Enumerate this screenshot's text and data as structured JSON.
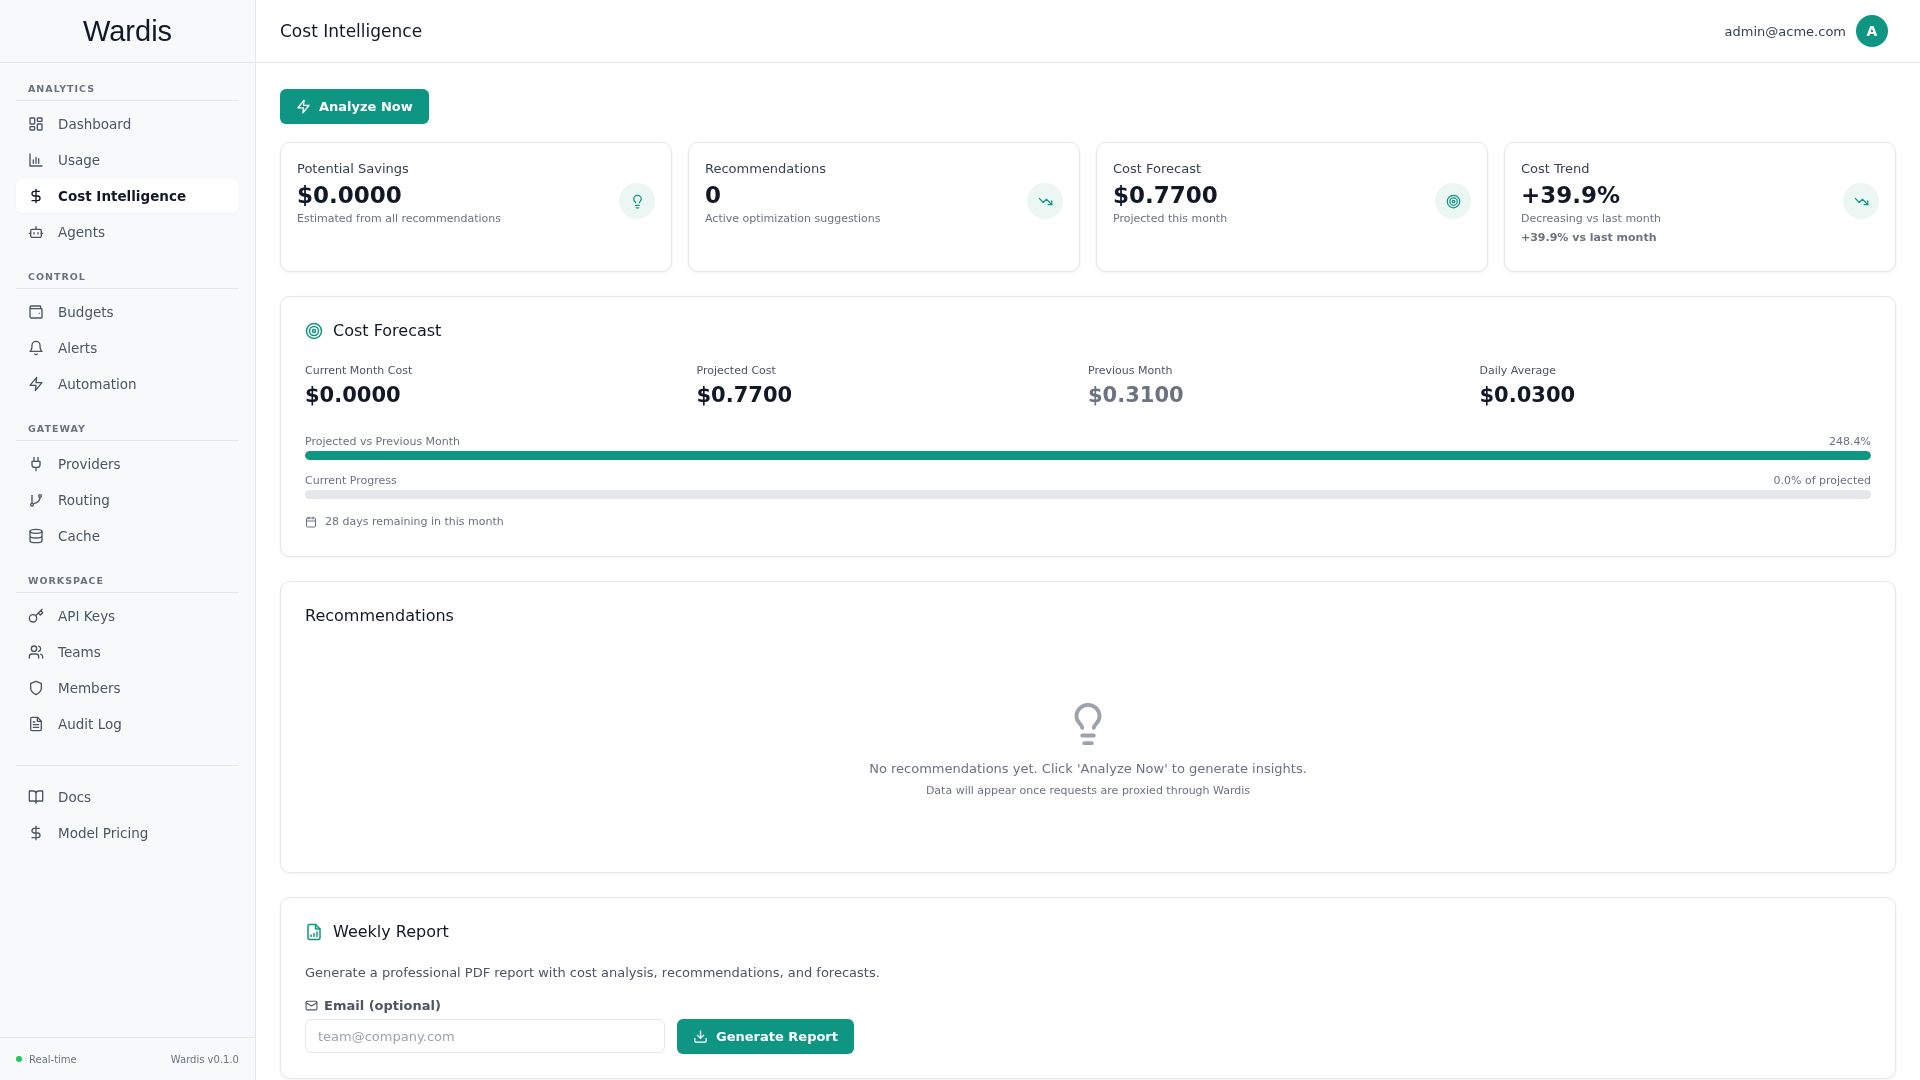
{
  "sidebar": {
    "logo": "Wardis",
    "sections": [
      {
        "title": "ANALYTICS",
        "items": [
          {
            "label": "Dashboard",
            "selected": false
          },
          {
            "label": "Usage",
            "selected": false
          },
          {
            "label": "Cost Intelligence",
            "selected": true
          },
          {
            "label": "Agents",
            "selected": false
          }
        ]
      },
      {
        "title": "CONTROL",
        "items": [
          {
            "label": "Budgets",
            "selected": false
          },
          {
            "label": "Alerts",
            "selected": false
          },
          {
            "label": "Automation",
            "selected": false
          }
        ]
      },
      {
        "title": "GATEWAY",
        "items": [
          {
            "label": "Providers",
            "selected": false
          },
          {
            "label": "Routing",
            "selected": false
          },
          {
            "label": "Cache",
            "selected": false
          }
        ]
      },
      {
        "title": "WORKSPACE",
        "items": [
          {
            "label": "API Keys",
            "selected": false
          },
          {
            "label": "Teams",
            "selected": false
          },
          {
            "label": "Members",
            "selected": false
          },
          {
            "label": "Audit Log",
            "selected": false
          }
        ]
      }
    ],
    "links": [
      {
        "label": "Docs",
        "selected": false
      },
      {
        "label": "Model Pricing",
        "selected": false
      }
    ],
    "status": "Real-time",
    "version": "Wardis v0.1.0"
  },
  "header": {
    "title": "Cost Intelligence",
    "user": "admin@acme.com",
    "avatar": "A"
  },
  "analyze_button": "Analyze Now",
  "stat_cards": [
    {
      "title": "Potential Savings",
      "value": "$0.0000",
      "caption": "Estimated from all recommendations"
    },
    {
      "title": "Recommendations",
      "value": "0",
      "caption": "Active optimization suggestions"
    },
    {
      "title": "Cost Forecast",
      "value": "$0.7700",
      "caption": "Projected this month"
    },
    {
      "title": "Cost Trend",
      "value": "+39.9%",
      "caption": "Decreasing vs last month",
      "note": "+39.9% vs last month"
    }
  ],
  "forecast": {
    "title": "Cost Forecast",
    "metrics": [
      {
        "label": "Current Month Cost",
        "value": "$0.0000",
        "muted": false
      },
      {
        "label": "Projected Cost",
        "value": "$0.7700",
        "muted": false
      },
      {
        "label": "Previous Month",
        "value": "$0.3100",
        "muted": true
      },
      {
        "label": "Daily Average",
        "value": "$0.0300",
        "muted": false
      }
    ],
    "bars": [
      {
        "label": "Projected vs Previous Month",
        "reading": "248.4%",
        "level": 1
      },
      {
        "label": "Current Progress",
        "reading": "0.0% of projected",
        "level": 0
      }
    ],
    "remaining": "28 days remaining in this month"
  },
  "recommendations": {
    "title": "Recommendations",
    "empty_text": "No recommendations yet. Click 'Analyze Now' to generate insights.",
    "empty_hint": "Data will appear once requests are proxied through Wardis"
  },
  "weekly_report": {
    "title": "Weekly Report",
    "description": "Generate a professional PDF report with cost analysis, recommendations, and forecasts.",
    "email_label": "Email (optional)",
    "email_placeholder": "team@company.com",
    "button": "Generate Report"
  }
}
